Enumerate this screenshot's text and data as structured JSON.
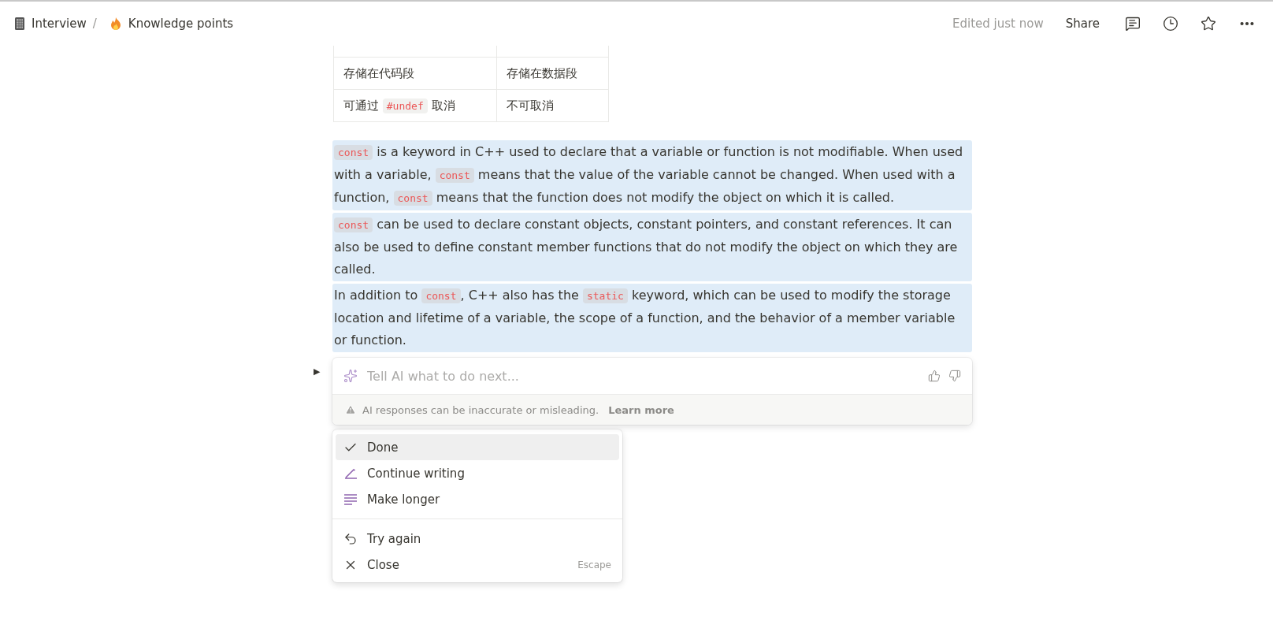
{
  "breadcrumb": [
    {
      "label": "Interview",
      "kind": "notebook"
    },
    {
      "label": "Knowledge points",
      "kind": "fire"
    }
  ],
  "toggle": "▶",
  "separator": "/",
  "topbar": {
    "status": "Edited just now",
    "share": "Share"
  },
  "table": {
    "rows": [
      [
        [
          {
            "kind": "text",
            "text": "存储在代码段"
          }
        ],
        [
          {
            "kind": "text",
            "text": "存储在数据段"
          }
        ]
      ],
      [
        [
          {
            "kind": "text",
            "text": "可通过 "
          },
          {
            "kind": "code",
            "text": "#undef"
          },
          {
            "kind": "text",
            "text": " 取消"
          }
        ],
        [
          {
            "kind": "text",
            "text": "不可取消"
          }
        ]
      ]
    ]
  },
  "paragraphs": [
    {
      "selected": true,
      "segments": [
        {
          "kind": "code",
          "text": "const"
        },
        {
          "kind": "text",
          "text": " is a keyword in C++ used to declare that a variable or function is not modifiable. When used with a variable, "
        },
        {
          "kind": "code",
          "text": "const"
        },
        {
          "kind": "text",
          "text": " means that the value of the variable cannot be changed. When used with a function, "
        },
        {
          "kind": "code",
          "text": "const"
        },
        {
          "kind": "text",
          "text": " means that the function does not modify the object on which it is called."
        }
      ]
    },
    {
      "selected": true,
      "segments": [
        {
          "kind": "code",
          "text": "const"
        },
        {
          "kind": "text",
          "text": " can be used to declare constant objects, constant pointers, and constant references. It can also be used to define constant member functions that do not modify the object on which they are called."
        }
      ]
    },
    {
      "selected": true,
      "segments": [
        {
          "kind": "text",
          "text": "In addition to "
        },
        {
          "kind": "code",
          "text": "const"
        },
        {
          "kind": "text",
          "text": ", C++ also has the "
        },
        {
          "kind": "code",
          "text": "static"
        },
        {
          "kind": "text",
          "text": " keyword, which can be used to modify the storage location and lifetime of a variable, the scope of a function, and the behavior of a member variable or function."
        }
      ]
    }
  ],
  "ai_prompt": {
    "placeholder": "Tell AI what to do next...",
    "warning": "AI responses can be inaccurate or misleading.",
    "learn_more": "Learn more"
  },
  "menu": {
    "groups": [
      [
        {
          "label": "Done",
          "kind": "check",
          "selected": true
        },
        {
          "label": "Continue writing",
          "kind": "pen",
          "selected": false
        },
        {
          "label": "Make longer",
          "kind": "lines",
          "selected": false
        }
      ],
      [
        {
          "label": "Try again",
          "kind": "undo",
          "selected": false
        },
        {
          "label": "Close",
          "kind": "close",
          "selected": false,
          "shortcut": "Escape"
        }
      ]
    ]
  }
}
